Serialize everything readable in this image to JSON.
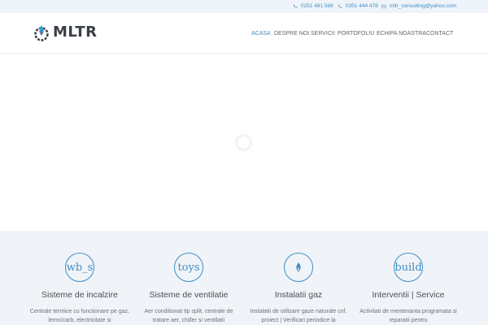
{
  "topbar": {
    "phone1": "0251 481 568",
    "phone2": "0351 444 478",
    "email": "mltr_consulting@yahoo.com"
  },
  "header": {
    "logo_text": "MLTR",
    "nav": [
      "ACASA",
      "DESPRE NOI",
      "SERVICII",
      "PORTOFOLIU",
      "ECHIPA NOASTRA",
      "CONTACT"
    ]
  },
  "services": [
    {
      "icon": "wb_s",
      "title": "Sisteme de incalzire",
      "desc": "Centrale termice cu functionare pe gaz, lemn/carb, electricitate si"
    },
    {
      "icon": "toys",
      "title": "Sisteme de ventilatie",
      "desc": "Aer conditionat tip split, centrale de tratare aer, chiller si ventilatii"
    },
    {
      "icon": "",
      "title": "Instalatii gaz",
      "desc": "Instalatii de utilizare gaze naturale cnf. proiect | Verificari periodice la"
    },
    {
      "icon": "build",
      "title": "Interventii | Service",
      "desc": "Activitati de mentenanta programata si reparatii pentru"
    }
  ],
  "colors": {
    "accent": "#3f8dc6",
    "topbar_bg": "#eef4f9",
    "services_bg": "#f0f4f8"
  }
}
